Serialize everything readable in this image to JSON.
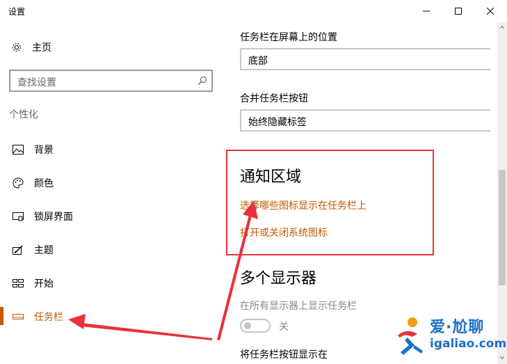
{
  "window": {
    "title": "设置"
  },
  "sidebar": {
    "home_label": "主页",
    "search_placeholder": "查找设置",
    "section_title": "个性化",
    "items": [
      {
        "label": "背景",
        "icon": "picture-icon"
      },
      {
        "label": "颜色",
        "icon": "palette-icon"
      },
      {
        "label": "锁屏界面",
        "icon": "lock-screen-icon"
      },
      {
        "label": "主题",
        "icon": "brush-icon"
      },
      {
        "label": "开始",
        "icon": "start-tiles-icon"
      },
      {
        "label": "任务栏",
        "icon": "taskbar-icon",
        "selected": true
      }
    ]
  },
  "main": {
    "taskbar_position": {
      "label": "任务栏在屏幕上的位置",
      "value": "底部"
    },
    "combine_buttons": {
      "label": "合并任务栏按钮",
      "value": "始终隐藏标签"
    },
    "notification_area": {
      "heading": "通知区域",
      "link_icons": "选择哪些图标显示在任务栏上",
      "link_system_icons": "打开或关闭系统图标"
    },
    "multiple_displays": {
      "heading": "多个显示器",
      "show_on_all_label": "在所有显示器上显示任务栏",
      "toggle_state": "关",
      "show_buttons_label": "将任务栏按钮显示在"
    }
  },
  "watermark": {
    "title": "爱·尬聊",
    "url": "igaliao.com"
  },
  "colors": {
    "accent": "#c15a00",
    "highlight": "#e8313a",
    "watermark": "#1a6fc9"
  }
}
